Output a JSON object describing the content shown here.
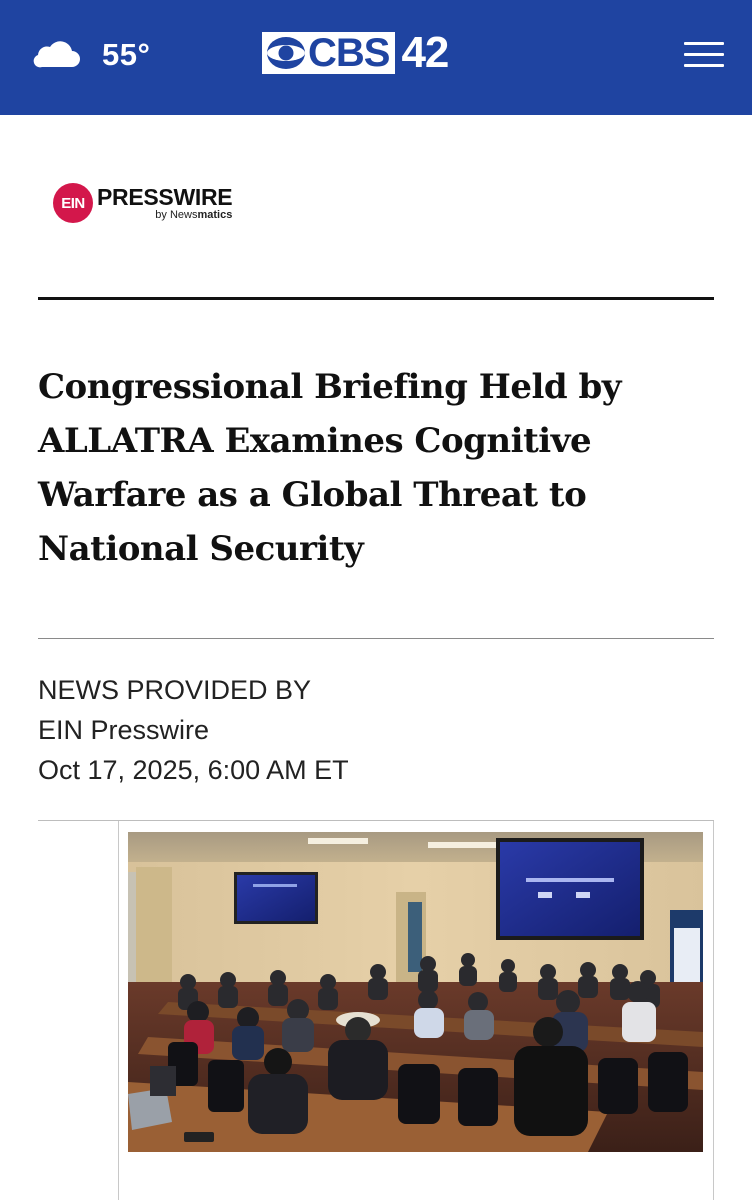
{
  "header": {
    "weather_icon": "partly-cloudy-icon",
    "temperature": "55°",
    "logo": {
      "network": "CBS",
      "channel": "42"
    },
    "menu_icon": "hamburger-menu-icon",
    "colors": {
      "bar": "#1f44a1",
      "text": "#ffffff"
    }
  },
  "source_logo": {
    "mark": "EIN",
    "word": "PRESSWIRE",
    "byline_prefix": "by News",
    "byline_suffix": "matics",
    "accent": "#d3174b"
  },
  "article": {
    "headline": "Congressional Briefing Held by ALLATRA Examines Cognitive Warfare as a Global Threat to National Security",
    "provided_label": "NEWS PROVIDED BY",
    "provider": "EIN Presswire",
    "date": "Oct 17, 2025, 6:00 AM ET"
  },
  "photo": {
    "description_icon": "conference-room-photo"
  }
}
